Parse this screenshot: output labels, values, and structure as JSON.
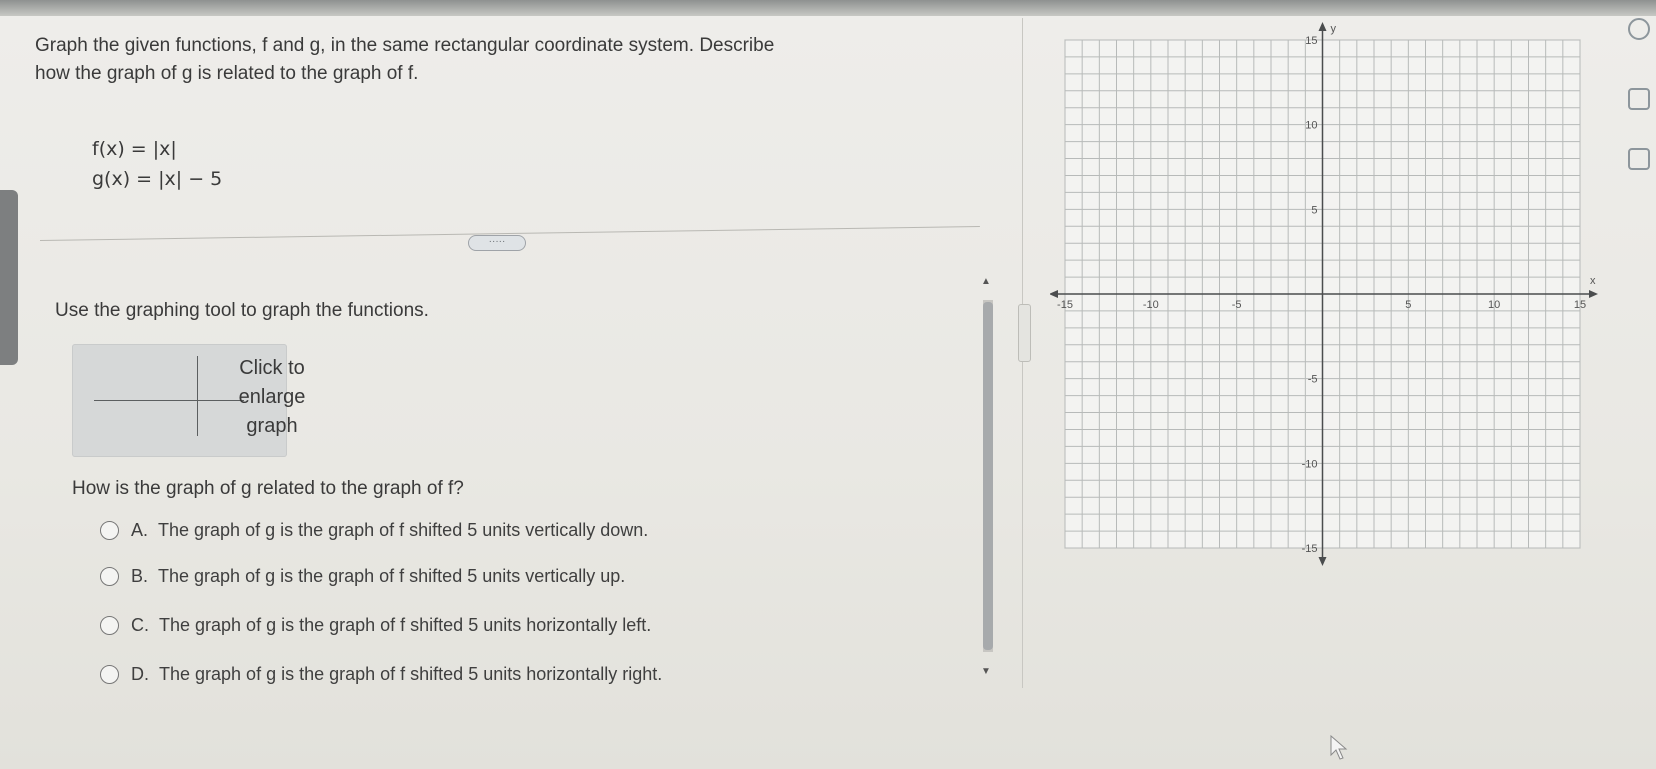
{
  "question": {
    "line1": "Graph the given functions, f and g, in the same rectangular coordinate system. Describe",
    "line2": "how the graph of g is related to the graph of f."
  },
  "functions": {
    "f": "f(x) = |x|",
    "g": "g(x) = |x| − 5"
  },
  "more_button": "·····",
  "instruction": "Use the graphing tool to graph the functions.",
  "thumbnail": {
    "line1": "Click to",
    "line2": "enlarge",
    "line3": "graph"
  },
  "question2": "How is the graph of g related to the graph of f?",
  "options": [
    {
      "letter": "A.",
      "text": "The graph of g is the graph of f shifted 5 units vertically down."
    },
    {
      "letter": "B.",
      "text": "The graph of g is the graph of f shifted 5 units vertically up."
    },
    {
      "letter": "C.",
      "text": "The graph of g is the graph of f shifted 5 units horizontally left."
    },
    {
      "letter": "D.",
      "text": "The graph of g is the graph of f shifted 5 units horizontally right."
    }
  ],
  "graph": {
    "y_axis_label": "y",
    "x_axis_label": "x",
    "x_range": [
      -15,
      15
    ],
    "y_range": [
      -15,
      15
    ],
    "x_ticks": [
      "-15",
      "-10",
      "-5",
      "5",
      "10",
      "15"
    ],
    "y_ticks": [
      "15",
      "10",
      "5",
      "-5",
      "-10",
      "-15"
    ],
    "grid": true
  },
  "icons": {
    "side": [
      "zoom-in-icon",
      "zoom-out-icon",
      "expand-icon"
    ],
    "cursor": "mouse-cursor-icon"
  },
  "colors": {
    "grid_line": "#b7bab9",
    "axis": "#4b4d4e",
    "page_bg": "#eceae6"
  }
}
